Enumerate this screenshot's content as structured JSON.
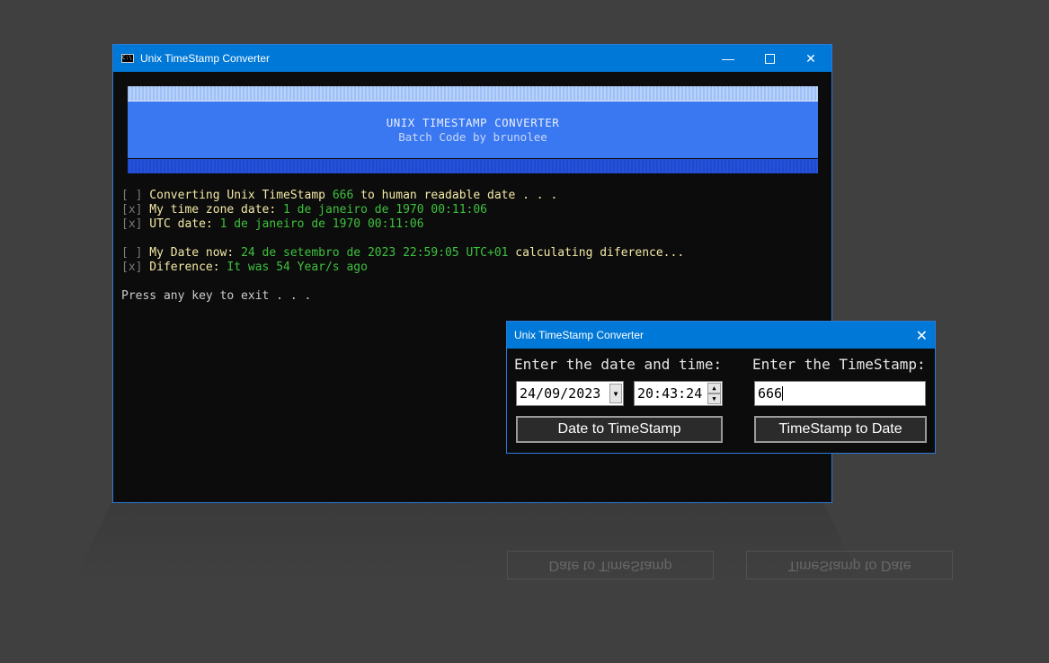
{
  "console": {
    "title": "Unix TimeStamp Converter",
    "banner_title": "UNIX TIMESTAMP CONVERTER",
    "banner_sub": "Batch Code by brunolee",
    "lines": {
      "l1_box": "[ ]",
      "l1_a": " Converting Unix TimeStamp ",
      "l1_val": "666",
      "l1_b": " to human readable date . . .",
      "l2_box": "[x]",
      "l2_a": " My time zone date: ",
      "l2_val": "1 de janeiro de 1970 00:11:06",
      "l3_box": "[x]",
      "l3_a": " UTC date: ",
      "l3_val": "1 de janeiro de 1970 00:11:06",
      "l4_box": "[ ]",
      "l4_a": " My Date now: ",
      "l4_val": "24 de setembro de 2023 22:59:05 UTC+01",
      "l4_b": " calculating diference...",
      "l5_box": "[x]",
      "l5_a": " Diference: ",
      "l5_val": "It was 54 Year/s ago",
      "l6": "Press any key to exit . . ."
    }
  },
  "dialog": {
    "title": "Unix TimeStamp Converter",
    "date_label": "Enter the date and time:",
    "ts_label": "Enter the TimeStamp:",
    "date_value": "24/09/2023",
    "time_value": "20:43:24",
    "ts_value": "666",
    "btn_date_to_ts": "Date to TimeStamp",
    "btn_ts_to_date": "TimeStamp to Date"
  },
  "colors": {
    "titlebar": "#0078d7",
    "banner": "#3a78f2",
    "green": "#3ec13e",
    "yellow": "#f3e9a6"
  }
}
